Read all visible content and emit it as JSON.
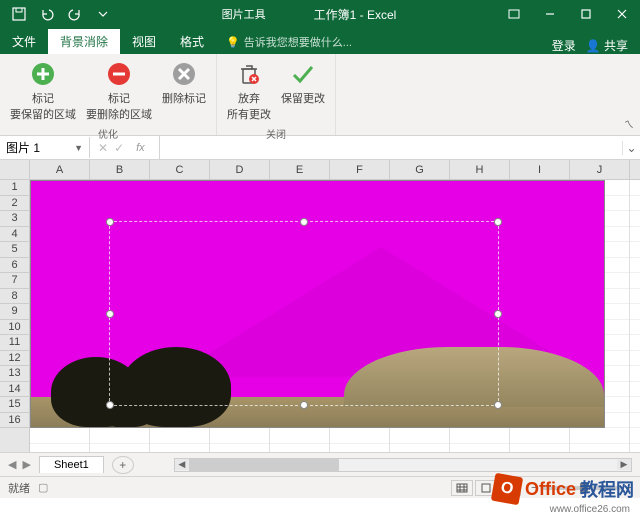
{
  "titlebar": {
    "picture_tools": "图片工具",
    "title": "工作簿1 - Excel"
  },
  "tabs": {
    "file": "文件",
    "bg_remove": "背景消除",
    "view": "视图",
    "format": "格式",
    "tell_me": "告诉我您想要做什么...",
    "login": "登录",
    "share": "共享"
  },
  "ribbon": {
    "mark_keep": {
      "l1": "标记",
      "l2": "要保留的区域"
    },
    "mark_remove": {
      "l1": "标记",
      "l2": "要删除的区域"
    },
    "delete_mark": "删除标记",
    "discard": {
      "l1": "放弃",
      "l2": "所有更改"
    },
    "keep": "保留更改",
    "group_refine": "优化",
    "group_close": "关闭"
  },
  "namebox": {
    "value": "图片 1"
  },
  "fx": {
    "label": "fx"
  },
  "columns": [
    "A",
    "B",
    "C",
    "D",
    "E",
    "F",
    "G",
    "H",
    "I",
    "J"
  ],
  "rows": [
    "1",
    "2",
    "3",
    "4",
    "5",
    "6",
    "7",
    "8",
    "9",
    "10",
    "11",
    "12",
    "13",
    "14",
    "15",
    "16"
  ],
  "sheet_tabs": {
    "sheet1": "Sheet1"
  },
  "statusbar": {
    "ready": "就绪",
    "zoom_minus": "−",
    "zoom_plus": "+"
  },
  "watermark": {
    "brand1": "Office",
    "brand2": "教程网",
    "url": "www.office26.com",
    "icon": "O"
  }
}
